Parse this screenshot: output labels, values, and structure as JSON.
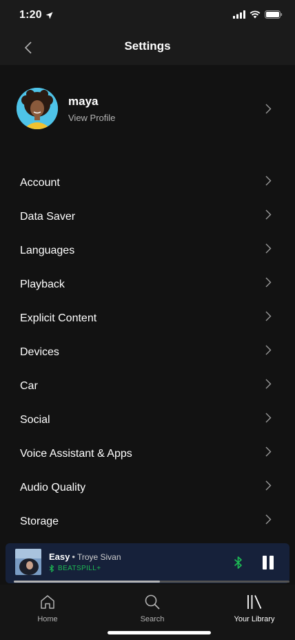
{
  "status_bar": {
    "time": "1:20"
  },
  "nav": {
    "title": "Settings"
  },
  "profile": {
    "name": "maya",
    "subtitle": "View Profile"
  },
  "settings": [
    {
      "label": "Account"
    },
    {
      "label": "Data Saver"
    },
    {
      "label": "Languages"
    },
    {
      "label": "Playback"
    },
    {
      "label": "Explicit Content"
    },
    {
      "label": "Devices"
    },
    {
      "label": "Car"
    },
    {
      "label": "Social"
    },
    {
      "label": "Voice Assistant & Apps"
    },
    {
      "label": "Audio Quality"
    },
    {
      "label": "Storage"
    }
  ],
  "now_playing": {
    "title": "Easy",
    "separator": "•",
    "artist": "Troye Sivan",
    "device": "BEATSPILL+",
    "progress": 0.53
  },
  "tabs": [
    {
      "label": "Home",
      "icon": "home-icon",
      "active": false
    },
    {
      "label": "Search",
      "icon": "search-icon",
      "active": false
    },
    {
      "label": "Your Library",
      "icon": "library-icon",
      "active": true
    }
  ],
  "colors": {
    "background": "#121212",
    "header": "#1b1b1b",
    "accent_green": "#1db954",
    "mini_player": "#16213a",
    "secondary_text": "#b3b3b3"
  }
}
